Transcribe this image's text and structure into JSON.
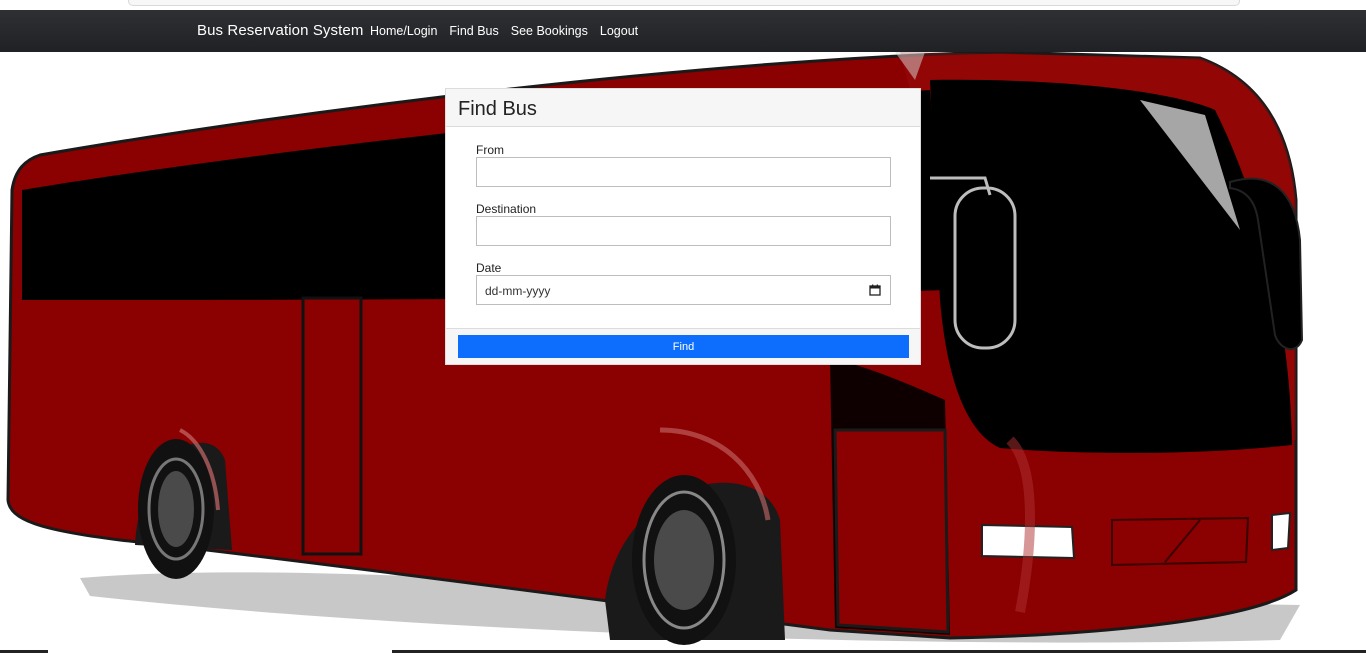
{
  "navbar": {
    "brand": "Bus Reservation System",
    "links": [
      "Home/Login",
      "Find Bus",
      "See Bookings",
      "Logout"
    ]
  },
  "form": {
    "title": "Find Bus",
    "from_label": "From",
    "from_value": "",
    "destination_label": "Destination",
    "destination_value": "",
    "date_label": "Date",
    "date_placeholder": "dd-mm-yyyy",
    "submit_label": "Find"
  },
  "colors": {
    "navbar": "#232427",
    "accent": "#0d6efd",
    "bus_body": "#8b0000"
  },
  "icons": {
    "calendar": "calendar-icon",
    "hero": "bus-illustration"
  }
}
